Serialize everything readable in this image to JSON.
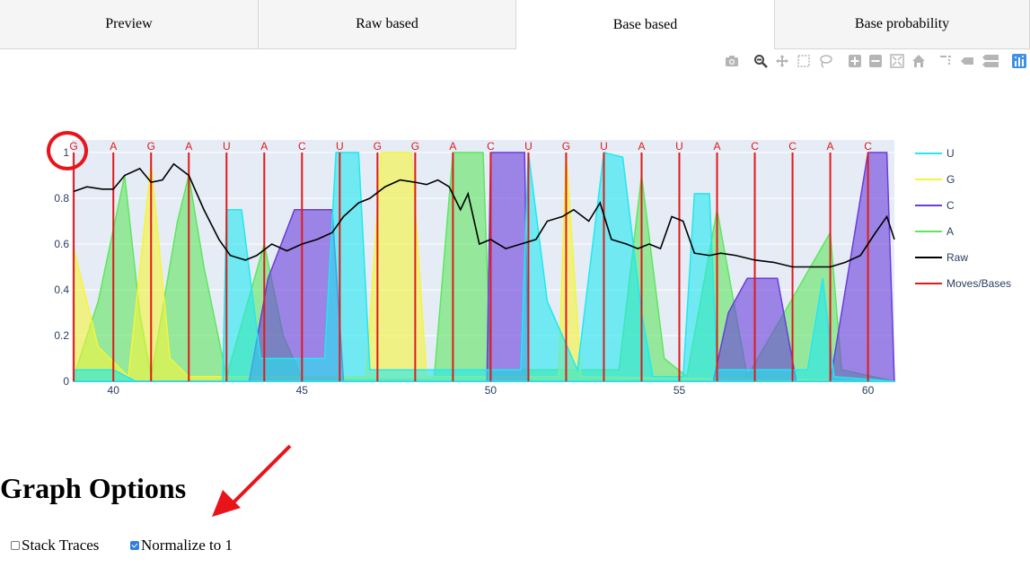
{
  "tabs": [
    {
      "label": "Preview",
      "active": false
    },
    {
      "label": "Raw based",
      "active": false
    },
    {
      "label": "Base based",
      "active": true
    },
    {
      "label": "Base probability",
      "active": false
    }
  ],
  "modebar": [
    "camera-icon",
    "zoom-icon",
    "pan-icon",
    "box-select-icon",
    "lasso-icon",
    "zoom-in-icon",
    "zoom-out-icon",
    "autoscale-icon",
    "reset-axes-icon",
    "spike-lines-icon",
    "hover-closest-icon",
    "hover-compare-icon",
    "plotly-logo-icon"
  ],
  "chart_data": {
    "type": "area",
    "x_range": [
      38.9,
      60.7
    ],
    "y_range": [
      0,
      1
    ],
    "x_ticks": [
      40,
      45,
      50,
      55,
      60
    ],
    "y_ticks": [
      0,
      0.2,
      0.4,
      0.6,
      0.8,
      1
    ],
    "grid": true,
    "legend_placement": "right",
    "colors": {
      "U": "#22e8f0",
      "G": "#f5f53a",
      "C": "#6a3ddc",
      "A": "#5fe65f",
      "Raw": "#000000",
      "Moves": "#e01a1a"
    },
    "bases": [
      {
        "x": 38.95,
        "label": "G"
      },
      {
        "x": 40.0,
        "label": "A"
      },
      {
        "x": 41.0,
        "label": "G"
      },
      {
        "x": 42.0,
        "label": "A"
      },
      {
        "x": 43.0,
        "label": "U"
      },
      {
        "x": 44.0,
        "label": "A"
      },
      {
        "x": 45.0,
        "label": "C"
      },
      {
        "x": 46.0,
        "label": "U"
      },
      {
        "x": 47.0,
        "label": "G"
      },
      {
        "x": 48.0,
        "label": "G"
      },
      {
        "x": 49.0,
        "label": "A"
      },
      {
        "x": 50.0,
        "label": "C"
      },
      {
        "x": 51.0,
        "label": "U"
      },
      {
        "x": 52.0,
        "label": "G"
      },
      {
        "x": 53.0,
        "label": "U"
      },
      {
        "x": 54.0,
        "label": "A"
      },
      {
        "x": 55.0,
        "label": "U"
      },
      {
        "x": 56.0,
        "label": "A"
      },
      {
        "x": 57.0,
        "label": "C"
      },
      {
        "x": 58.0,
        "label": "C"
      },
      {
        "x": 59.0,
        "label": "A"
      },
      {
        "x": 60.0,
        "label": "C"
      }
    ],
    "series": [
      {
        "name": "A",
        "points": [
          [
            38.95,
            0.02
          ],
          [
            39.6,
            0.35
          ],
          [
            40.3,
            0.9
          ],
          [
            40.7,
            0.3
          ],
          [
            41.0,
            0.02
          ],
          [
            41.7,
            0.7
          ],
          [
            42.0,
            0.9
          ],
          [
            42.4,
            0.5
          ],
          [
            43.0,
            0.02
          ],
          [
            44.0,
            0.6
          ],
          [
            44.5,
            0.2
          ],
          [
            45.0,
            0.01
          ],
          [
            48.5,
            0.01
          ],
          [
            49.0,
            1.0
          ],
          [
            49.8,
            1.0
          ],
          [
            50.0,
            0.05
          ],
          [
            53.4,
            0.05
          ],
          [
            54.0,
            0.9
          ],
          [
            54.6,
            0.1
          ],
          [
            55.2,
            0.02
          ],
          [
            56.0,
            0.75
          ],
          [
            56.8,
            0.02
          ],
          [
            59.0,
            0.65
          ],
          [
            59.3,
            0.05
          ],
          [
            60.7,
            0.0
          ]
        ]
      },
      {
        "name": "G",
        "points": [
          [
            38.95,
            0.58
          ],
          [
            39.6,
            0.15
          ],
          [
            40.4,
            0.02
          ],
          [
            41.0,
            0.95
          ],
          [
            41.5,
            0.1
          ],
          [
            42.0,
            0.02
          ],
          [
            46.7,
            0.02
          ],
          [
            47.1,
            1.0
          ],
          [
            47.9,
            1.0
          ],
          [
            48.3,
            0.02
          ],
          [
            51.8,
            0.02
          ],
          [
            52.0,
            1.0
          ],
          [
            52.4,
            0.02
          ],
          [
            60.7,
            0.0
          ]
        ]
      },
      {
        "name": "C",
        "points": [
          [
            38.95,
            0.0
          ],
          [
            43.6,
            0.0
          ],
          [
            44.1,
            0.45
          ],
          [
            44.8,
            0.75
          ],
          [
            45.8,
            0.75
          ],
          [
            46.1,
            0.0
          ],
          [
            49.9,
            0.0
          ],
          [
            50.0,
            1.0
          ],
          [
            50.9,
            1.0
          ],
          [
            51.0,
            0.0
          ],
          [
            55.9,
            0.0
          ],
          [
            56.3,
            0.3
          ],
          [
            56.8,
            0.45
          ],
          [
            57.6,
            0.45
          ],
          [
            58.1,
            0.0
          ],
          [
            59.0,
            0.0
          ],
          [
            60.0,
            1.0
          ],
          [
            60.5,
            1.0
          ],
          [
            60.7,
            0.0
          ]
        ]
      },
      {
        "name": "U",
        "points": [
          [
            38.95,
            0.05
          ],
          [
            39.5,
            0.05
          ],
          [
            40.0,
            0.05
          ],
          [
            40.6,
            0.0
          ],
          [
            42.9,
            0.0
          ],
          [
            43.0,
            0.75
          ],
          [
            43.4,
            0.75
          ],
          [
            43.9,
            0.1
          ],
          [
            45.6,
            0.1
          ],
          [
            45.9,
            1.0
          ],
          [
            46.5,
            1.0
          ],
          [
            46.8,
            0.05
          ],
          [
            50.8,
            0.05
          ],
          [
            51.0,
            1.0
          ],
          [
            51.5,
            0.35
          ],
          [
            52.3,
            0.05
          ],
          [
            53.0,
            1.0
          ],
          [
            53.5,
            0.98
          ],
          [
            54.0,
            0.3
          ],
          [
            54.3,
            0.02
          ],
          [
            55.1,
            0.02
          ],
          [
            55.4,
            0.82
          ],
          [
            55.8,
            0.82
          ],
          [
            56.0,
            0.05
          ],
          [
            58.4,
            0.05
          ],
          [
            58.8,
            0.45
          ],
          [
            59.1,
            0.02
          ],
          [
            60.7,
            0.0
          ]
        ]
      },
      {
        "name": "Raw",
        "points": [
          [
            38.95,
            0.83
          ],
          [
            39.3,
            0.85
          ],
          [
            39.7,
            0.84
          ],
          [
            40.0,
            0.84
          ],
          [
            40.3,
            0.9
          ],
          [
            40.7,
            0.93
          ],
          [
            41.0,
            0.87
          ],
          [
            41.3,
            0.88
          ],
          [
            41.6,
            0.95
          ],
          [
            42.0,
            0.9
          ],
          [
            42.4,
            0.75
          ],
          [
            42.8,
            0.62
          ],
          [
            43.1,
            0.55
          ],
          [
            43.5,
            0.53
          ],
          [
            43.8,
            0.55
          ],
          [
            44.2,
            0.6
          ],
          [
            44.6,
            0.57
          ],
          [
            45.0,
            0.6
          ],
          [
            45.4,
            0.62
          ],
          [
            45.8,
            0.65
          ],
          [
            46.1,
            0.72
          ],
          [
            46.5,
            0.78
          ],
          [
            46.8,
            0.8
          ],
          [
            47.2,
            0.85
          ],
          [
            47.6,
            0.88
          ],
          [
            48.0,
            0.87
          ],
          [
            48.3,
            0.86
          ],
          [
            48.6,
            0.88
          ],
          [
            48.9,
            0.85
          ],
          [
            49.2,
            0.75
          ],
          [
            49.4,
            0.82
          ],
          [
            49.7,
            0.6
          ],
          [
            50.0,
            0.62
          ],
          [
            50.4,
            0.58
          ],
          [
            50.8,
            0.6
          ],
          [
            51.2,
            0.62
          ],
          [
            51.5,
            0.7
          ],
          [
            51.9,
            0.72
          ],
          [
            52.2,
            0.75
          ],
          [
            52.6,
            0.7
          ],
          [
            52.9,
            0.78
          ],
          [
            53.2,
            0.62
          ],
          [
            53.6,
            0.6
          ],
          [
            53.9,
            0.58
          ],
          [
            54.2,
            0.6
          ],
          [
            54.5,
            0.58
          ],
          [
            54.8,
            0.72
          ],
          [
            55.1,
            0.7
          ],
          [
            55.4,
            0.56
          ],
          [
            55.8,
            0.55
          ],
          [
            56.1,
            0.56
          ],
          [
            56.5,
            0.55
          ],
          [
            57.0,
            0.53
          ],
          [
            57.5,
            0.52
          ],
          [
            58.0,
            0.5
          ],
          [
            58.5,
            0.5
          ],
          [
            59.0,
            0.5
          ],
          [
            59.4,
            0.52
          ],
          [
            59.8,
            0.55
          ],
          [
            60.2,
            0.65
          ],
          [
            60.5,
            0.72
          ],
          [
            60.7,
            0.62
          ]
        ]
      }
    ],
    "legend": [
      "U",
      "G",
      "C",
      "A",
      "Raw",
      "Moves/Bases"
    ]
  },
  "options": {
    "heading": "Graph Options",
    "stack_label": "Stack Traces",
    "stack_checked": false,
    "normalize_label": "Normalize to 1",
    "normalize_checked": true
  }
}
